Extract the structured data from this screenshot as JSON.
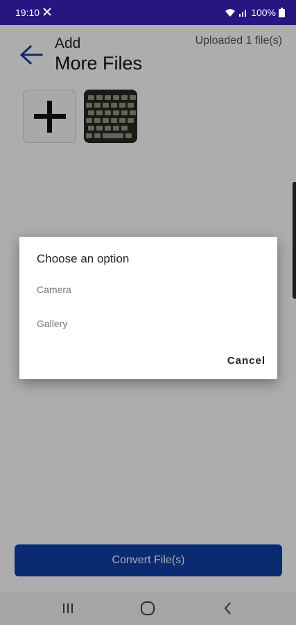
{
  "status_bar": {
    "time": "19:10",
    "battery": "100%",
    "icons": [
      "silent-icon",
      "wifi-icon",
      "signal-icon",
      "battery-icon"
    ]
  },
  "header": {
    "title_line1": "Add",
    "title_line2": "More Files",
    "uploaded_status": "Uploaded 1 file(s)"
  },
  "files": {
    "add_icon": "plus-icon",
    "items": [
      {
        "type": "image-thumbnail",
        "alt": "keyboard photo"
      }
    ]
  },
  "dialog": {
    "title": "Choose an option",
    "options": [
      "Camera",
      "Gallery"
    ],
    "cancel_label": "Cancel"
  },
  "actions": {
    "convert_label": "Convert File(s)"
  },
  "nav_bar": {
    "icons": [
      "recents-icon",
      "home-icon",
      "back-icon"
    ]
  },
  "colors": {
    "status_bar": "#271680",
    "accent": "#0f3fa8",
    "back_arrow": "#1a3fa0"
  }
}
